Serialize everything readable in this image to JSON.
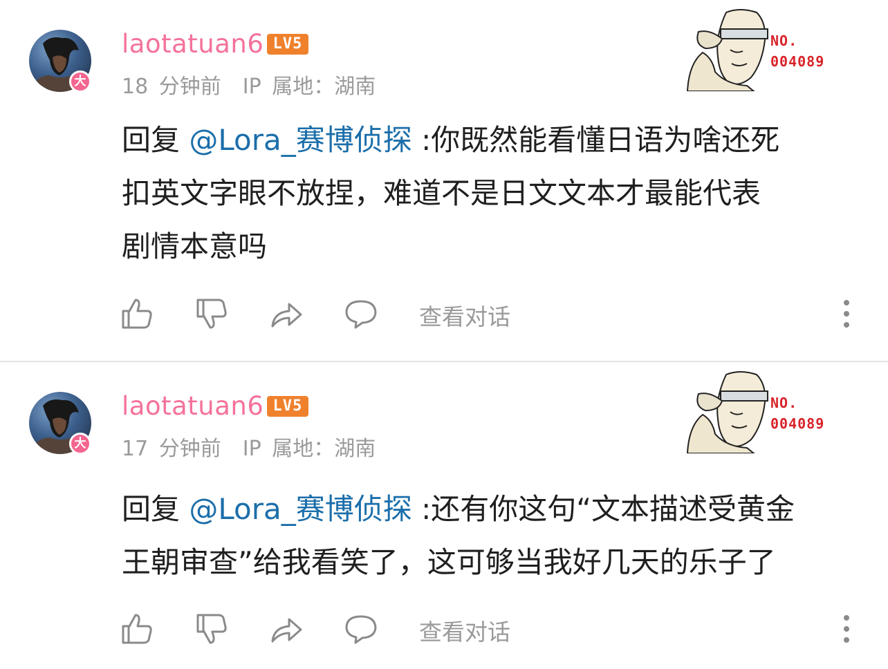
{
  "comments": [
    {
      "username": "laotatuan6",
      "level": "LV5",
      "vip_badge": "大",
      "time": "18 分钟前",
      "ip": "IP 属地：湖南",
      "decor_no": "NO.",
      "decor_num": "004089",
      "reply_prefix": "回复 ",
      "mention": "@Lora_赛博侦探",
      "line1_rest": " :你既然能看懂日语为啥还死",
      "line2": "扣英文字眼不放捏，难道不是日文文本才最能代表",
      "line3": "剧情本意吗",
      "view_conversation": "查看对话"
    },
    {
      "username": "laotatuan6",
      "level": "LV5",
      "vip_badge": "大",
      "time": "17 分钟前",
      "ip": "IP 属地：湖南",
      "decor_no": "NO.",
      "decor_num": "004089",
      "reply_prefix": "回复 ",
      "mention": "@Lora_赛博侦探",
      "line1_rest": " :还有你这句“文本描述受黄金",
      "line2": "王朝审查”给我看笑了，这可够当我好几天的乐子了",
      "view_conversation": "查看对话"
    }
  ],
  "icons": [
    "like-icon",
    "dislike-icon",
    "share-icon",
    "reply-icon",
    "more-icon"
  ],
  "colors": {
    "username": "#f4729a",
    "mention": "#1b6eaa",
    "level_badge": "#f0812c",
    "meta": "#9a9a9a",
    "decor_number": "#d8232a"
  }
}
